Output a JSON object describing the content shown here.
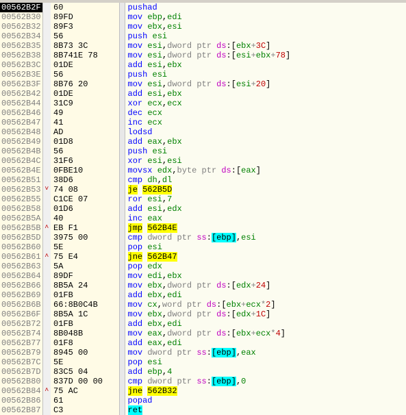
{
  "rows": [
    {
      "addr": "00562B2F",
      "sel": true,
      "mark": "",
      "bytes": "60",
      "tokens": [
        {
          "t": "pushad",
          "c": "mn"
        }
      ]
    },
    {
      "addr": "00562B30",
      "mark": "",
      "bytes": "89FD",
      "tokens": [
        {
          "t": "mov",
          "c": "mn"
        },
        {
          "t": " "
        },
        {
          "t": "ebp",
          "c": "reg"
        },
        {
          "t": ",",
          "c": "comma"
        },
        {
          "t": "edi",
          "c": "reg"
        }
      ]
    },
    {
      "addr": "00562B32",
      "mark": "",
      "bytes": "89F3",
      "tokens": [
        {
          "t": "mov",
          "c": "mn"
        },
        {
          "t": " "
        },
        {
          "t": "ebx",
          "c": "reg"
        },
        {
          "t": ",",
          "c": "comma"
        },
        {
          "t": "esi",
          "c": "reg"
        }
      ]
    },
    {
      "addr": "00562B34",
      "mark": "",
      "bytes": "56",
      "tokens": [
        {
          "t": "push",
          "c": "mn"
        },
        {
          "t": " "
        },
        {
          "t": "esi",
          "c": "reg"
        }
      ]
    },
    {
      "addr": "00562B35",
      "mark": "",
      "bytes": "8B73 3C",
      "tokens": [
        {
          "t": "mov",
          "c": "mn"
        },
        {
          "t": " "
        },
        {
          "t": "esi",
          "c": "reg"
        },
        {
          "t": ",",
          "c": "comma"
        },
        {
          "t": "dword ptr ",
          "c": "gray"
        },
        {
          "t": "ds",
          "c": "seg"
        },
        {
          "t": ":",
          "c": "br"
        },
        {
          "t": "[",
          "c": "br"
        },
        {
          "t": "ebx",
          "c": "reg"
        },
        {
          "t": "+",
          "c": "gray"
        },
        {
          "t": "3C",
          "c": "imm-red"
        },
        {
          "t": "]",
          "c": "br"
        }
      ]
    },
    {
      "addr": "00562B38",
      "mark": "",
      "bytes": "8B741E 78",
      "tokens": [
        {
          "t": "mov",
          "c": "mn"
        },
        {
          "t": " "
        },
        {
          "t": "esi",
          "c": "reg"
        },
        {
          "t": ",",
          "c": "comma"
        },
        {
          "t": "dword ptr ",
          "c": "gray"
        },
        {
          "t": "ds",
          "c": "seg"
        },
        {
          "t": ":",
          "c": "br"
        },
        {
          "t": "[",
          "c": "br"
        },
        {
          "t": "esi",
          "c": "reg"
        },
        {
          "t": "+",
          "c": "gray"
        },
        {
          "t": "ebx",
          "c": "reg"
        },
        {
          "t": "+",
          "c": "gray"
        },
        {
          "t": "78",
          "c": "imm-red"
        },
        {
          "t": "]",
          "c": "br"
        }
      ]
    },
    {
      "addr": "00562B3C",
      "mark": "",
      "bytes": "01DE",
      "tokens": [
        {
          "t": "add",
          "c": "mn"
        },
        {
          "t": " "
        },
        {
          "t": "esi",
          "c": "reg"
        },
        {
          "t": ",",
          "c": "comma"
        },
        {
          "t": "ebx",
          "c": "reg"
        }
      ]
    },
    {
      "addr": "00562B3E",
      "mark": "",
      "bytes": "56",
      "tokens": [
        {
          "t": "push",
          "c": "mn"
        },
        {
          "t": " "
        },
        {
          "t": "esi",
          "c": "reg"
        }
      ]
    },
    {
      "addr": "00562B3F",
      "mark": "",
      "bytes": "8B76 20",
      "tokens": [
        {
          "t": "mov",
          "c": "mn"
        },
        {
          "t": " "
        },
        {
          "t": "esi",
          "c": "reg"
        },
        {
          "t": ",",
          "c": "comma"
        },
        {
          "t": "dword ptr ",
          "c": "gray"
        },
        {
          "t": "ds",
          "c": "seg"
        },
        {
          "t": ":",
          "c": "br"
        },
        {
          "t": "[",
          "c": "br"
        },
        {
          "t": "esi",
          "c": "reg"
        },
        {
          "t": "+",
          "c": "gray"
        },
        {
          "t": "20",
          "c": "imm-red"
        },
        {
          "t": "]",
          "c": "br"
        }
      ]
    },
    {
      "addr": "00562B42",
      "mark": "",
      "bytes": "01DE",
      "tokens": [
        {
          "t": "add",
          "c": "mn"
        },
        {
          "t": " "
        },
        {
          "t": "esi",
          "c": "reg"
        },
        {
          "t": ",",
          "c": "comma"
        },
        {
          "t": "ebx",
          "c": "reg"
        }
      ]
    },
    {
      "addr": "00562B44",
      "mark": "",
      "bytes": "31C9",
      "tokens": [
        {
          "t": "xor",
          "c": "mn"
        },
        {
          "t": " "
        },
        {
          "t": "ecx",
          "c": "reg"
        },
        {
          "t": ",",
          "c": "comma"
        },
        {
          "t": "ecx",
          "c": "reg"
        }
      ]
    },
    {
      "addr": "00562B46",
      "mark": "",
      "bytes": "49",
      "tokens": [
        {
          "t": "dec",
          "c": "mn"
        },
        {
          "t": " "
        },
        {
          "t": "ecx",
          "c": "reg"
        }
      ]
    },
    {
      "addr": "00562B47",
      "mark": "",
      "bytes": "41",
      "tokens": [
        {
          "t": "inc",
          "c": "mn"
        },
        {
          "t": " "
        },
        {
          "t": "ecx",
          "c": "reg"
        }
      ]
    },
    {
      "addr": "00562B48",
      "mark": "",
      "bytes": "AD",
      "tokens": [
        {
          "t": "lodsd",
          "c": "mn"
        }
      ]
    },
    {
      "addr": "00562B49",
      "mark": "",
      "bytes": "01D8",
      "tokens": [
        {
          "t": "add",
          "c": "mn"
        },
        {
          "t": " "
        },
        {
          "t": "eax",
          "c": "reg"
        },
        {
          "t": ",",
          "c": "comma"
        },
        {
          "t": "ebx",
          "c": "reg"
        }
      ]
    },
    {
      "addr": "00562B4B",
      "mark": "",
      "bytes": "56",
      "tokens": [
        {
          "t": "push",
          "c": "mn"
        },
        {
          "t": " "
        },
        {
          "t": "esi",
          "c": "reg"
        }
      ]
    },
    {
      "addr": "00562B4C",
      "mark": "",
      "bytes": "31F6",
      "tokens": [
        {
          "t": "xor",
          "c": "mn"
        },
        {
          "t": " "
        },
        {
          "t": "esi",
          "c": "reg"
        },
        {
          "t": ",",
          "c": "comma"
        },
        {
          "t": "esi",
          "c": "reg"
        }
      ]
    },
    {
      "addr": "00562B4E",
      "mark": "",
      "bytes": "0FBE10",
      "tokens": [
        {
          "t": "movsx",
          "c": "mn"
        },
        {
          "t": " "
        },
        {
          "t": "edx",
          "c": "reg"
        },
        {
          "t": ",",
          "c": "comma"
        },
        {
          "t": "byte ptr ",
          "c": "gray"
        },
        {
          "t": "ds",
          "c": "seg"
        },
        {
          "t": ":",
          "c": "br"
        },
        {
          "t": "[",
          "c": "br"
        },
        {
          "t": "eax",
          "c": "reg"
        },
        {
          "t": "]",
          "c": "br"
        }
      ]
    },
    {
      "addr": "00562B51",
      "mark": "",
      "bytes": "38D6",
      "tokens": [
        {
          "t": "cmp",
          "c": "mn"
        },
        {
          "t": " "
        },
        {
          "t": "dh",
          "c": "reg"
        },
        {
          "t": ",",
          "c": "comma"
        },
        {
          "t": "dl",
          "c": "reg"
        }
      ]
    },
    {
      "addr": "00562B53",
      "mark": "˅",
      "bytes": "74 08",
      "tokens": [
        {
          "t": "je",
          "c": "mn-hl"
        },
        {
          "t": " "
        },
        {
          "t": "562B5D",
          "c": "hl-yellow"
        }
      ]
    },
    {
      "addr": "00562B55",
      "mark": "",
      "bytes": "C1CE 07",
      "tokens": [
        {
          "t": "ror",
          "c": "mn"
        },
        {
          "t": " "
        },
        {
          "t": "esi",
          "c": "reg"
        },
        {
          "t": ",",
          "c": "comma"
        },
        {
          "t": "7",
          "c": "num"
        }
      ]
    },
    {
      "addr": "00562B58",
      "mark": "",
      "bytes": "01D6",
      "tokens": [
        {
          "t": "add",
          "c": "mn"
        },
        {
          "t": " "
        },
        {
          "t": "esi",
          "c": "reg"
        },
        {
          "t": ",",
          "c": "comma"
        },
        {
          "t": "edx",
          "c": "reg"
        }
      ]
    },
    {
      "addr": "00562B5A",
      "mark": "",
      "bytes": "40",
      "tokens": [
        {
          "t": "inc",
          "c": "mn"
        },
        {
          "t": " "
        },
        {
          "t": "eax",
          "c": "reg"
        }
      ]
    },
    {
      "addr": "00562B5B",
      "mark": "˄",
      "bytes": "EB F1",
      "tokens": [
        {
          "t": "jmp",
          "c": "mn-hl"
        },
        {
          "t": " "
        },
        {
          "t": "562B4E",
          "c": "hl-yellow"
        }
      ]
    },
    {
      "addr": "00562B5D",
      "mark": "",
      "bytes": "3975 00",
      "tokens": [
        {
          "t": "cmp",
          "c": "mn"
        },
        {
          "t": " "
        },
        {
          "t": "dword ptr ",
          "c": "gray"
        },
        {
          "t": "ss",
          "c": "seg"
        },
        {
          "t": ":",
          "c": "br"
        },
        {
          "t": "[",
          "c": "hl-cyan"
        },
        {
          "t": "ebp",
          "c": "hl-cyan"
        },
        {
          "t": "]",
          "c": "hl-cyan"
        },
        {
          "t": ",",
          "c": "comma"
        },
        {
          "t": "esi",
          "c": "reg"
        }
      ]
    },
    {
      "addr": "00562B60",
      "mark": "",
      "bytes": "5E",
      "tokens": [
        {
          "t": "pop",
          "c": "mn"
        },
        {
          "t": " "
        },
        {
          "t": "esi",
          "c": "reg"
        }
      ]
    },
    {
      "addr": "00562B61",
      "mark": "˄",
      "bytes": "75 E4",
      "tokens": [
        {
          "t": "jne",
          "c": "mn-hl"
        },
        {
          "t": " "
        },
        {
          "t": "562B47",
          "c": "hl-yellow"
        }
      ]
    },
    {
      "addr": "00562B63",
      "mark": "",
      "bytes": "5A",
      "tokens": [
        {
          "t": "pop",
          "c": "mn"
        },
        {
          "t": " "
        },
        {
          "t": "edx",
          "c": "reg"
        }
      ]
    },
    {
      "addr": "00562B64",
      "mark": "",
      "bytes": "89DF",
      "tokens": [
        {
          "t": "mov",
          "c": "mn"
        },
        {
          "t": " "
        },
        {
          "t": "edi",
          "c": "reg"
        },
        {
          "t": ",",
          "c": "comma"
        },
        {
          "t": "ebx",
          "c": "reg"
        }
      ]
    },
    {
      "addr": "00562B66",
      "mark": "",
      "bytes": "8B5A 24",
      "tokens": [
        {
          "t": "mov",
          "c": "mn"
        },
        {
          "t": " "
        },
        {
          "t": "ebx",
          "c": "reg"
        },
        {
          "t": ",",
          "c": "comma"
        },
        {
          "t": "dword ptr ",
          "c": "gray"
        },
        {
          "t": "ds",
          "c": "seg"
        },
        {
          "t": ":",
          "c": "br"
        },
        {
          "t": "[",
          "c": "br"
        },
        {
          "t": "edx",
          "c": "reg"
        },
        {
          "t": "+",
          "c": "gray"
        },
        {
          "t": "24",
          "c": "imm-red"
        },
        {
          "t": "]",
          "c": "br"
        }
      ]
    },
    {
      "addr": "00562B69",
      "mark": "",
      "bytes": "01FB",
      "tokens": [
        {
          "t": "add",
          "c": "mn"
        },
        {
          "t": " "
        },
        {
          "t": "ebx",
          "c": "reg"
        },
        {
          "t": ",",
          "c": "comma"
        },
        {
          "t": "edi",
          "c": "reg"
        }
      ]
    },
    {
      "addr": "00562B6B",
      "mark": "",
      "bytes": "66:8B0C4B",
      "tokens": [
        {
          "t": "mov",
          "c": "mn"
        },
        {
          "t": " "
        },
        {
          "t": "cx",
          "c": "reg"
        },
        {
          "t": ",",
          "c": "comma"
        },
        {
          "t": "word ptr ",
          "c": "gray"
        },
        {
          "t": "ds",
          "c": "seg"
        },
        {
          "t": ":",
          "c": "br"
        },
        {
          "t": "[",
          "c": "br"
        },
        {
          "t": "ebx",
          "c": "reg"
        },
        {
          "t": "+",
          "c": "gray"
        },
        {
          "t": "ecx",
          "c": "reg"
        },
        {
          "t": "*",
          "c": "gray"
        },
        {
          "t": "2",
          "c": "imm-red"
        },
        {
          "t": "]",
          "c": "br"
        }
      ]
    },
    {
      "addr": "00562B6F",
      "mark": "",
      "bytes": "8B5A 1C",
      "tokens": [
        {
          "t": "mov",
          "c": "mn"
        },
        {
          "t": " "
        },
        {
          "t": "ebx",
          "c": "reg"
        },
        {
          "t": ",",
          "c": "comma"
        },
        {
          "t": "dword ptr ",
          "c": "gray"
        },
        {
          "t": "ds",
          "c": "seg"
        },
        {
          "t": ":",
          "c": "br"
        },
        {
          "t": "[",
          "c": "br"
        },
        {
          "t": "edx",
          "c": "reg"
        },
        {
          "t": "+",
          "c": "gray"
        },
        {
          "t": "1C",
          "c": "imm-red"
        },
        {
          "t": "]",
          "c": "br"
        }
      ]
    },
    {
      "addr": "00562B72",
      "mark": "",
      "bytes": "01FB",
      "tokens": [
        {
          "t": "add",
          "c": "mn"
        },
        {
          "t": " "
        },
        {
          "t": "ebx",
          "c": "reg"
        },
        {
          "t": ",",
          "c": "comma"
        },
        {
          "t": "edi",
          "c": "reg"
        }
      ]
    },
    {
      "addr": "00562B74",
      "mark": "",
      "bytes": "8B048B",
      "tokens": [
        {
          "t": "mov",
          "c": "mn"
        },
        {
          "t": " "
        },
        {
          "t": "eax",
          "c": "reg"
        },
        {
          "t": ",",
          "c": "comma"
        },
        {
          "t": "dword ptr ",
          "c": "gray"
        },
        {
          "t": "ds",
          "c": "seg"
        },
        {
          "t": ":",
          "c": "br"
        },
        {
          "t": "[",
          "c": "br"
        },
        {
          "t": "ebx",
          "c": "reg"
        },
        {
          "t": "+",
          "c": "gray"
        },
        {
          "t": "ecx",
          "c": "reg"
        },
        {
          "t": "*",
          "c": "gray"
        },
        {
          "t": "4",
          "c": "imm-red"
        },
        {
          "t": "]",
          "c": "br"
        }
      ]
    },
    {
      "addr": "00562B77",
      "mark": "",
      "bytes": "01F8",
      "tokens": [
        {
          "t": "add",
          "c": "mn"
        },
        {
          "t": " "
        },
        {
          "t": "eax",
          "c": "reg"
        },
        {
          "t": ",",
          "c": "comma"
        },
        {
          "t": "edi",
          "c": "reg"
        }
      ]
    },
    {
      "addr": "00562B79",
      "mark": "",
      "bytes": "8945 00",
      "tokens": [
        {
          "t": "mov",
          "c": "mn"
        },
        {
          "t": " "
        },
        {
          "t": "dword ptr ",
          "c": "gray"
        },
        {
          "t": "ss",
          "c": "seg"
        },
        {
          "t": ":",
          "c": "br"
        },
        {
          "t": "[",
          "c": "hl-cyan"
        },
        {
          "t": "ebp",
          "c": "hl-cyan"
        },
        {
          "t": "]",
          "c": "hl-cyan"
        },
        {
          "t": ",",
          "c": "comma"
        },
        {
          "t": "eax",
          "c": "reg"
        }
      ]
    },
    {
      "addr": "00562B7C",
      "mark": "",
      "bytes": "5E",
      "tokens": [
        {
          "t": "pop",
          "c": "mn"
        },
        {
          "t": " "
        },
        {
          "t": "esi",
          "c": "reg"
        }
      ]
    },
    {
      "addr": "00562B7D",
      "mark": "",
      "bytes": "83C5 04",
      "tokens": [
        {
          "t": "add",
          "c": "mn"
        },
        {
          "t": " "
        },
        {
          "t": "ebp",
          "c": "reg"
        },
        {
          "t": ",",
          "c": "comma"
        },
        {
          "t": "4",
          "c": "num"
        }
      ]
    },
    {
      "addr": "00562B80",
      "mark": "",
      "bytes": "837D 00 00",
      "tokens": [
        {
          "t": "cmp",
          "c": "mn"
        },
        {
          "t": " "
        },
        {
          "t": "dword ptr ",
          "c": "gray"
        },
        {
          "t": "ss",
          "c": "seg"
        },
        {
          "t": ":",
          "c": "br"
        },
        {
          "t": "[",
          "c": "hl-cyan"
        },
        {
          "t": "ebp",
          "c": "hl-cyan"
        },
        {
          "t": "]",
          "c": "hl-cyan"
        },
        {
          "t": ",",
          "c": "comma"
        },
        {
          "t": "0",
          "c": "num"
        }
      ]
    },
    {
      "addr": "00562B84",
      "mark": "˄",
      "bytes": "75 AC",
      "tokens": [
        {
          "t": "jne",
          "c": "mn-hl"
        },
        {
          "t": " "
        },
        {
          "t": "562B32",
          "c": "hl-yellow"
        }
      ]
    },
    {
      "addr": "00562B86",
      "mark": "",
      "bytes": "61",
      "tokens": [
        {
          "t": "popad",
          "c": "mn"
        }
      ]
    },
    {
      "addr": "00562B87",
      "mark": "",
      "bytes": "C3",
      "tokens": [
        {
          "t": "ret",
          "c": "mn-ret"
        }
      ]
    }
  ]
}
